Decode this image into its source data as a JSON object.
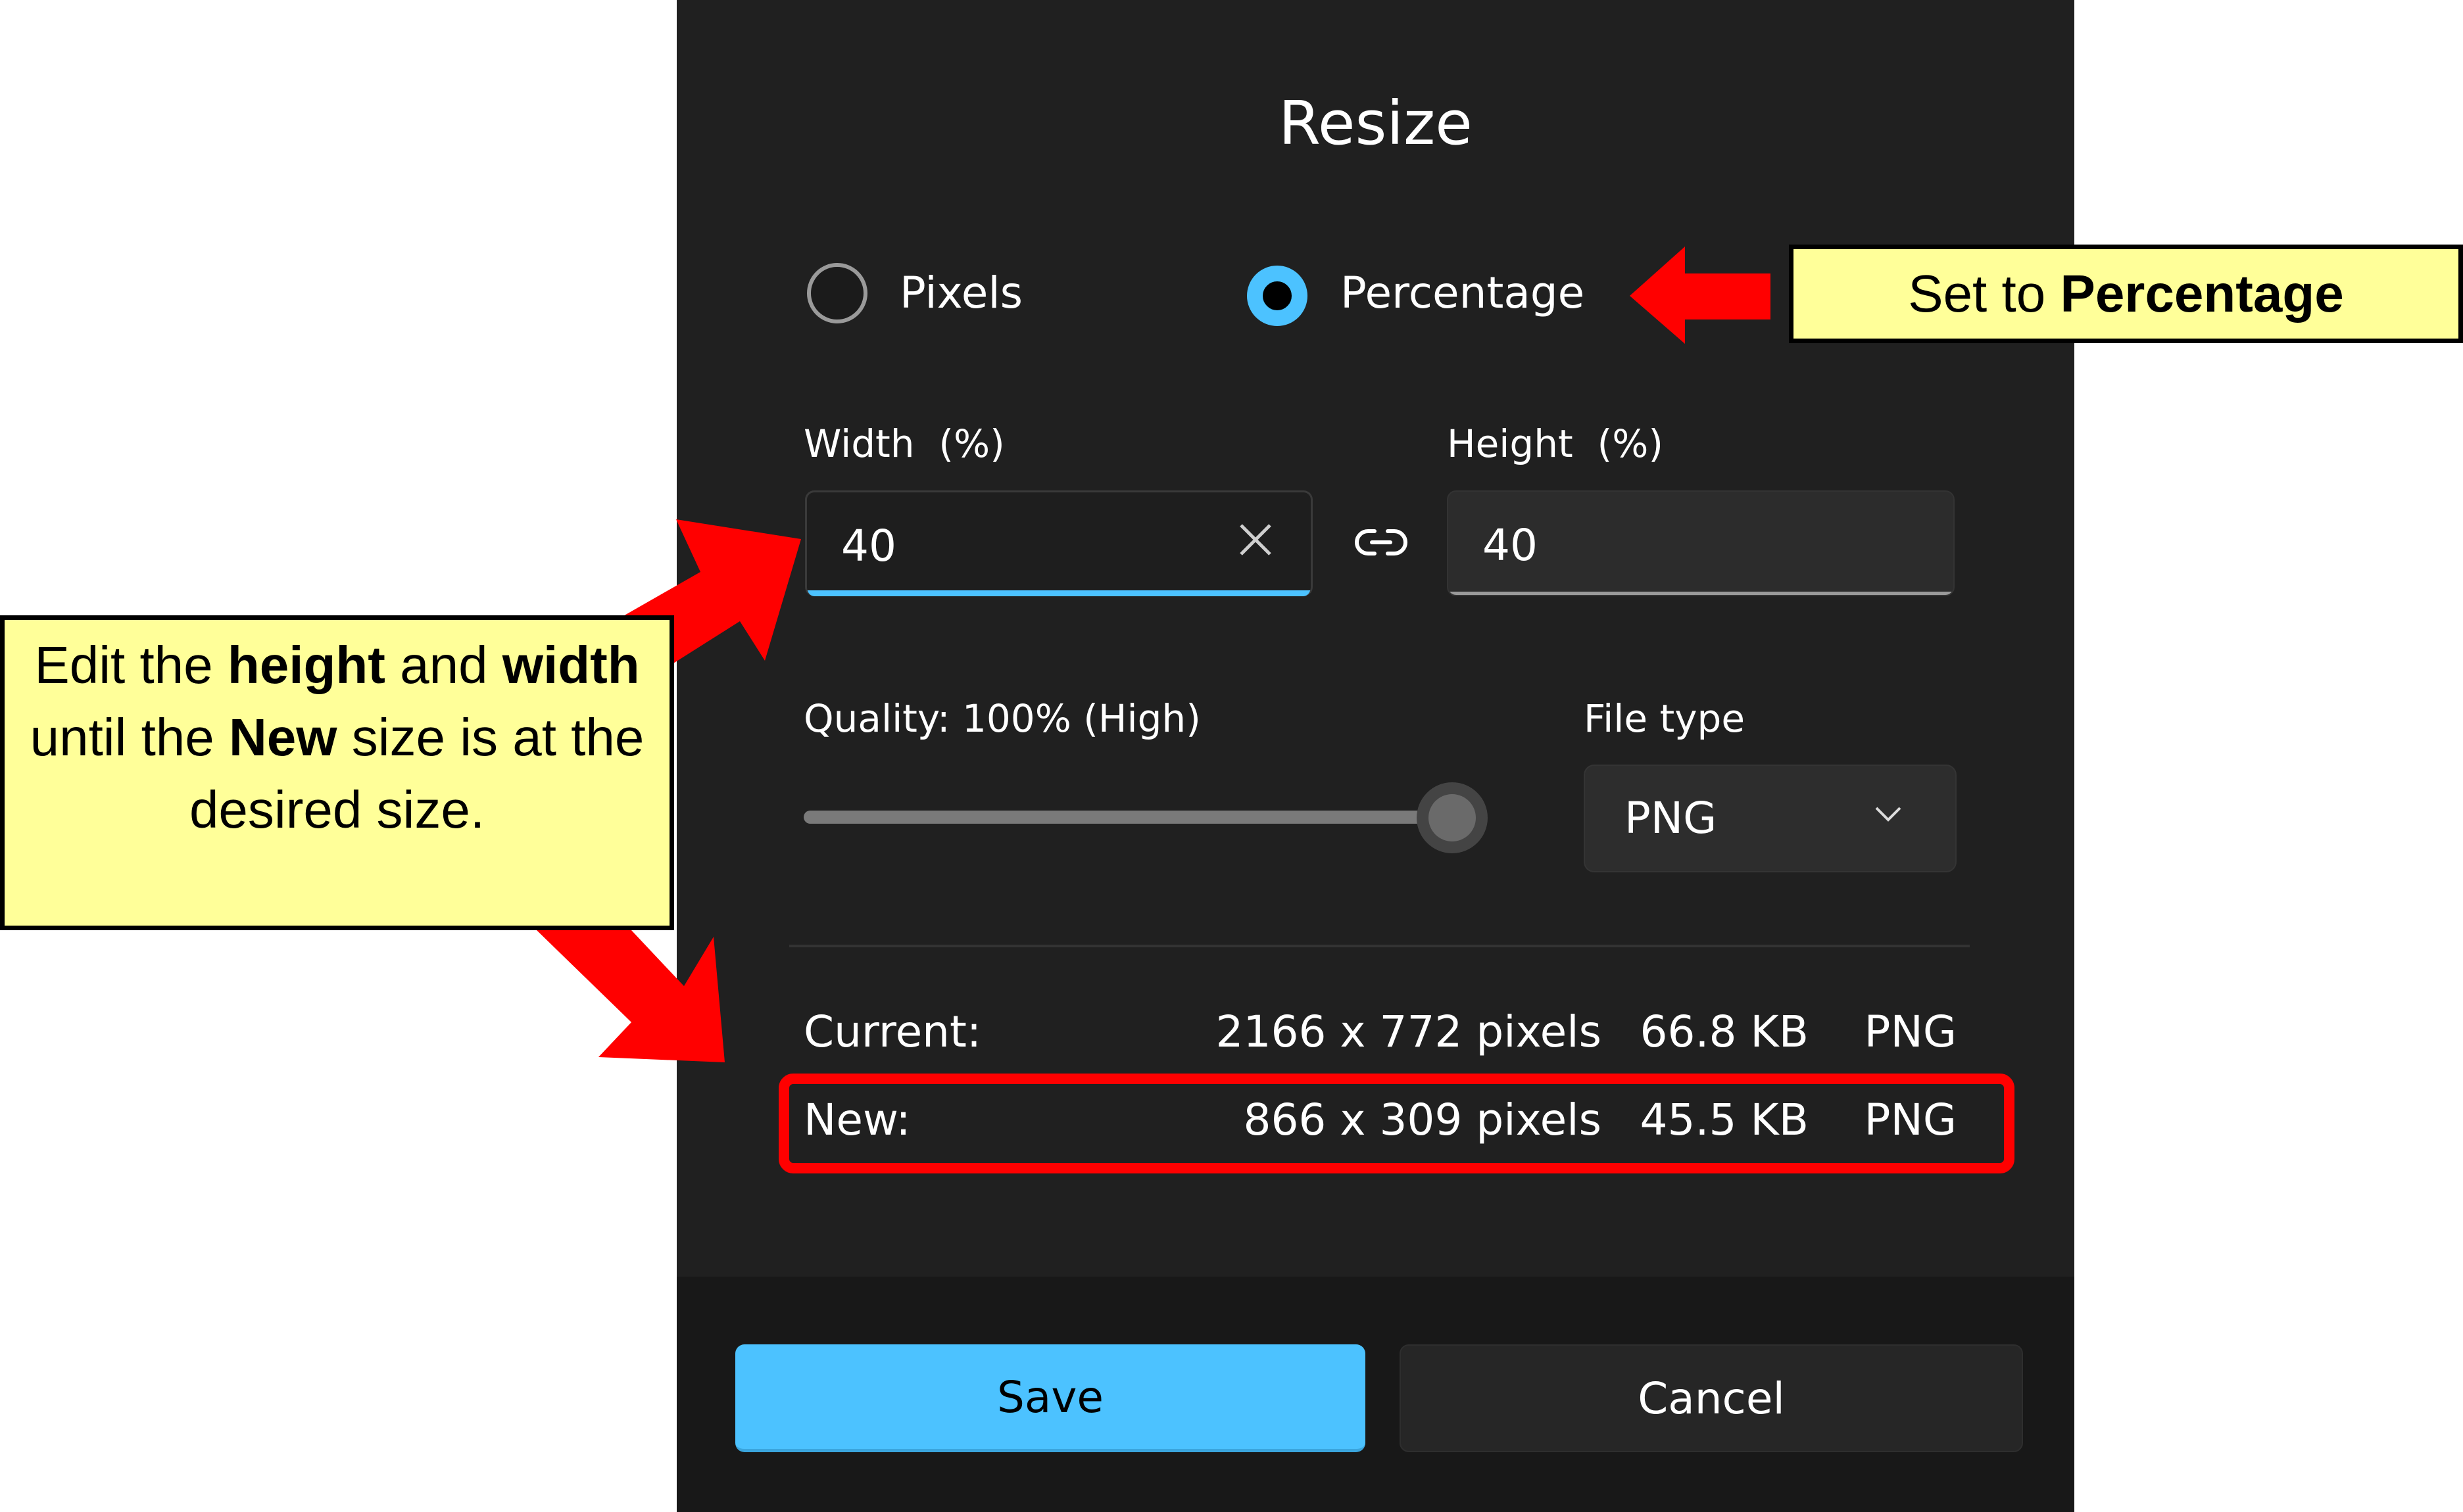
{
  "dialog": {
    "title": "Resize",
    "mode_options": [
      {
        "label": "Pixels",
        "selected": false
      },
      {
        "label": "Percentage",
        "selected": true
      }
    ],
    "width": {
      "label": "Width  (%)",
      "value": "40"
    },
    "height": {
      "label": "Height  (%)",
      "value": "40"
    },
    "aspect_lock_icon": "link-icon",
    "quality": {
      "label": "Quality: 100% (High)",
      "value_percent": 100
    },
    "file_type": {
      "label": "File type",
      "selected": "PNG"
    },
    "current": {
      "label": "Current:",
      "dimensions": "2166 x 772 pixels",
      "size": "66.8 KB",
      "format": "PNG"
    },
    "new": {
      "label": "New:",
      "dimensions": "866 x 309 pixels",
      "size": "45.5 KB",
      "format": "PNG"
    },
    "buttons": {
      "save": "Save",
      "cancel": "Cancel"
    }
  },
  "annotations": {
    "top_callout": {
      "prefix": "Set to ",
      "bold": "Percentage"
    },
    "left_callout": {
      "p1": "Edit the ",
      "b1": "height",
      "p2": " and ",
      "b2": "width",
      "p3": " until the ",
      "b3": "New",
      "p4": " size is at the desired size."
    }
  },
  "colors": {
    "accent": "#4cc2ff",
    "panel_bg": "#202020",
    "footer_bg": "#181818",
    "annotation_red": "#ff0000",
    "callout_fill": "#ffff99"
  }
}
